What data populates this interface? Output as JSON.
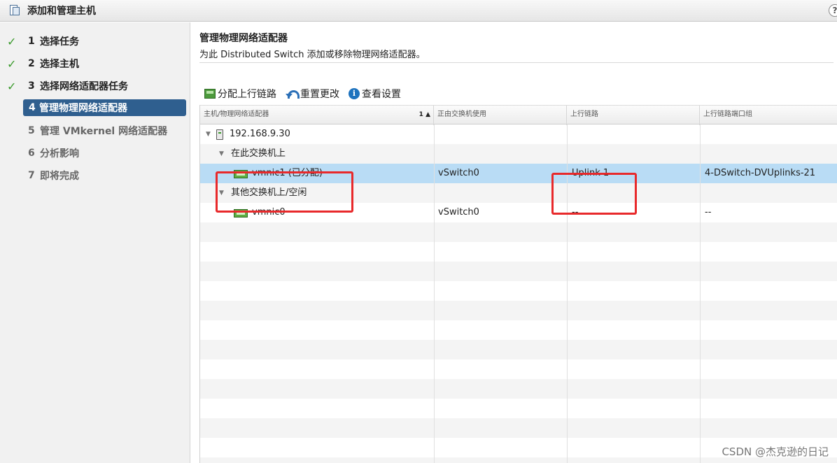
{
  "window": {
    "title": "添加和管理主机",
    "help_label": "?"
  },
  "steps": [
    {
      "num": "1",
      "label": "选择任务",
      "state": "done"
    },
    {
      "num": "2",
      "label": "选择主机",
      "state": "done"
    },
    {
      "num": "3",
      "label": "选择网络适配器任务",
      "state": "done"
    },
    {
      "num": "4",
      "label": "管理物理网络适配器",
      "state": "active"
    },
    {
      "num": "5",
      "label": "管理 VMkernel 网络适配器",
      "state": "todo"
    },
    {
      "num": "6",
      "label": "分析影响",
      "state": "todo"
    },
    {
      "num": "7",
      "label": "即将完成",
      "state": "todo"
    }
  ],
  "main": {
    "heading": "管理物理网络适配器",
    "subheading": "为此 Distributed Switch 添加或移除物理网络适配器。"
  },
  "toolbar": {
    "assign_uplink": "分配上行链路",
    "reset_changes": "重置更改",
    "view_settings": "查看设置",
    "info_glyph": "i"
  },
  "table": {
    "columns": [
      "主机/物理网络适配器",
      "正由交换机使用",
      "上行链路",
      "上行链路端口组"
    ],
    "sort_indicator": "1 ▲",
    "host": "192.168.9.30",
    "group_on_switch": "在此交换机上",
    "group_other": "其他交换机上/空闲",
    "rows": [
      {
        "adapter": "vmnic1 (已分配)",
        "switch": "vSwitch0",
        "uplink": "Uplink 1",
        "portgroup": "4-DSwitch-DVUplinks-21"
      },
      {
        "adapter": "vmnic0",
        "switch": "vSwitch0",
        "uplink": "--",
        "portgroup": "--"
      }
    ],
    "tree_expanded_glyph": "▼"
  },
  "highlight_color": "#e8292b",
  "watermark": "CSDN @杰克逊的日记"
}
